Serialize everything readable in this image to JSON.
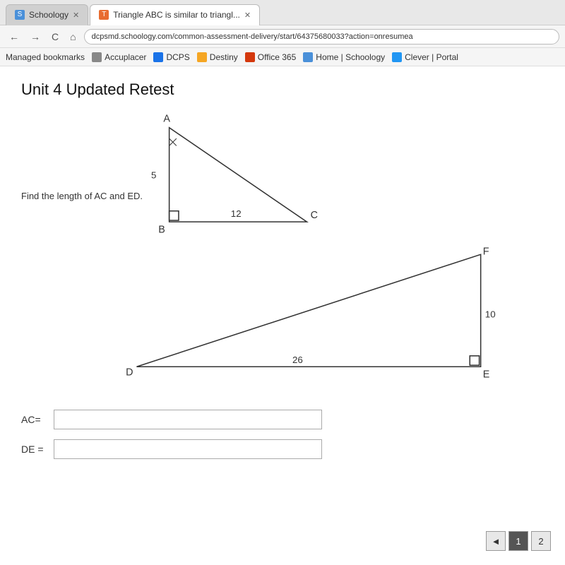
{
  "browser": {
    "tabs": [
      {
        "id": "tab-schoology",
        "label": "Schoology",
        "active": false,
        "icon_color": "#4a90d9"
      },
      {
        "id": "tab-triangle",
        "label": "Triangle ABC is similar to triangl...",
        "active": true,
        "icon_color": "#e86c30"
      }
    ],
    "address": "dcpsmd.schoology.com/common-assessment-delivery/start/64375680033?action=onresumea",
    "nav_back": "←",
    "nav_forward": "→",
    "nav_refresh": "C",
    "nav_home": "⌂"
  },
  "bookmarks": [
    {
      "id": "managed",
      "label": "Managed bookmarks"
    },
    {
      "id": "accuplacer",
      "label": "Accuplacer",
      "icon_color": "#888"
    },
    {
      "id": "dcps",
      "label": "DCPS",
      "icon_color": "#1a73e8"
    },
    {
      "id": "destiny",
      "label": "Destiny",
      "icon_color": "#f5a623"
    },
    {
      "id": "office365",
      "label": "Office 365",
      "icon_color": "#d4380d"
    },
    {
      "id": "home-schoology",
      "label": "Home | Schoology",
      "icon_color": "#4a90d9"
    },
    {
      "id": "clever",
      "label": "Clever | Portal",
      "icon_color": "#2196f3"
    }
  ],
  "page": {
    "title": "Unit 4 Updated Retest",
    "find_text": "Find the length of AC and ED.",
    "triangle_abc": {
      "label_a": "A",
      "label_b": "B",
      "label_c": "C",
      "side_ab": "5",
      "side_bc": "12"
    },
    "triangle_def": {
      "label_d": "D",
      "label_e": "E",
      "label_f": "F",
      "side_de": "26",
      "side_ef": "10"
    },
    "inputs": [
      {
        "id": "ac-input",
        "label": "AC=",
        "placeholder": ""
      },
      {
        "id": "de-input",
        "label": "DE =",
        "placeholder": ""
      }
    ],
    "pagination": {
      "prev_label": "◄",
      "current_page": "1",
      "next_label": "2"
    }
  }
}
